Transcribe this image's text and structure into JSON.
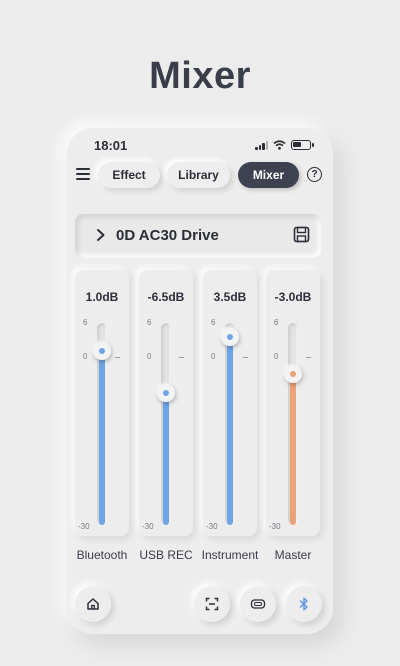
{
  "page": {
    "title": "Mixer"
  },
  "status_bar": {
    "time": "18:01",
    "icons": [
      "signal-icon",
      "wifi-icon",
      "battery-icon"
    ]
  },
  "nav": {
    "menu_icon": "menu-icon",
    "tabs": [
      {
        "label": "Effect",
        "active": false
      },
      {
        "label": "Library",
        "active": false
      },
      {
        "label": "Mixer",
        "active": true
      }
    ],
    "help_icon": "help-icon",
    "help_label": "?"
  },
  "preset": {
    "name": "0D AC30 Drive",
    "icons": [
      "chevron-right-icon",
      "save-icon"
    ]
  },
  "mixer": {
    "scale": {
      "max_label": "6",
      "zero_label": "0",
      "min_label": "-30",
      "max": 6,
      "min": -30
    },
    "channels": [
      {
        "name": "Bluetooth",
        "value_label": "1.0dB",
        "value_db": 1.0,
        "color": "#6fa4e6"
      },
      {
        "name": "USB REC",
        "value_label": "-6.5dB",
        "value_db": -6.5,
        "color": "#6fa4e6"
      },
      {
        "name": "Instrument",
        "value_label": "3.5dB",
        "value_db": 3.5,
        "color": "#6fa4e6"
      },
      {
        "name": "Master",
        "value_label": "-3.0dB",
        "value_db": -3.0,
        "color": "#eca277"
      }
    ]
  },
  "bottom_bar": {
    "buttons": [
      "home-icon",
      "scan-icon",
      "amp-icon",
      "bluetooth-icon"
    ]
  },
  "colors": {
    "active_tab": "#3d4150",
    "accent_blue": "#6fa4e6",
    "accent_orange": "#eca277"
  }
}
